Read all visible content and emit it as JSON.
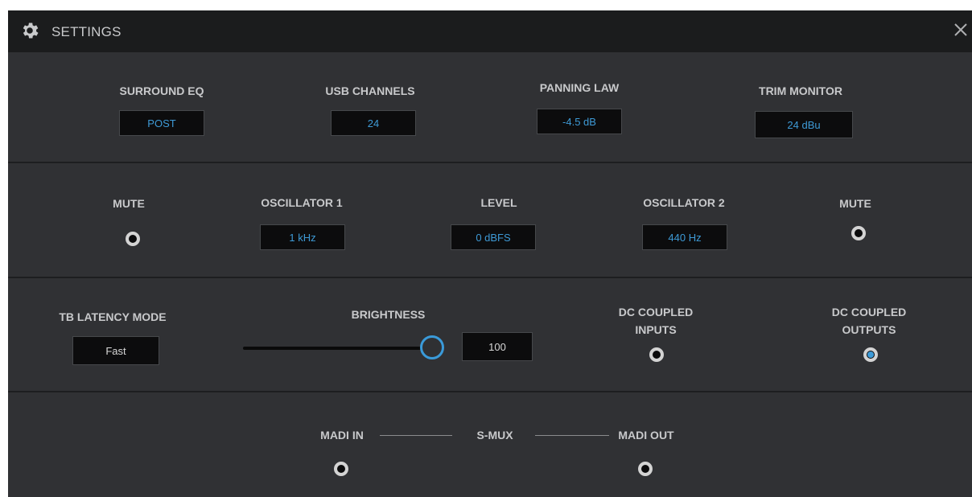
{
  "title": "SETTINGS",
  "icons": {
    "gear": "gear-icon",
    "close": "close-icon"
  },
  "colors": {
    "accent": "#3e9ad6",
    "background": "#303134",
    "titlebar": "#1b1c1d"
  },
  "row1": {
    "surround_eq": {
      "label": "SURROUND EQ",
      "value": "POST"
    },
    "usb_channels": {
      "label": "USB CHANNELS",
      "value": "24"
    },
    "panning_law": {
      "label": "PANNING LAW",
      "value": "-4.5 dB"
    },
    "trim_monitor": {
      "label": "TRIM MONITOR",
      "value": "24 dBu"
    }
  },
  "row2": {
    "mute1": {
      "label": "MUTE",
      "on": false
    },
    "osc1": {
      "label": "OSCILLATOR 1",
      "value": "1 kHz"
    },
    "level": {
      "label": "LEVEL",
      "value": "0 dBFS"
    },
    "osc2": {
      "label": "OSCILLATOR 2",
      "value": "440 Hz"
    },
    "mute2": {
      "label": "MUTE",
      "on": false
    }
  },
  "row3": {
    "tb_latency": {
      "label": "TB LATENCY MODE",
      "value": "Fast"
    },
    "brightness": {
      "label": "BRIGHTNESS",
      "value": "100",
      "level_percent": 100
    },
    "dc_inputs": {
      "label_line1": "DC COUPLED",
      "label_line2": "INPUTS",
      "on": false
    },
    "dc_outputs": {
      "label_line1": "DC COUPLED",
      "label_line2": "OUTPUTS",
      "on": true
    }
  },
  "row4": {
    "madi_in": {
      "label": "MADI IN",
      "on": false
    },
    "smux": {
      "label": "S-MUX"
    },
    "madi_out": {
      "label": "MADI OUT",
      "on": false
    }
  }
}
